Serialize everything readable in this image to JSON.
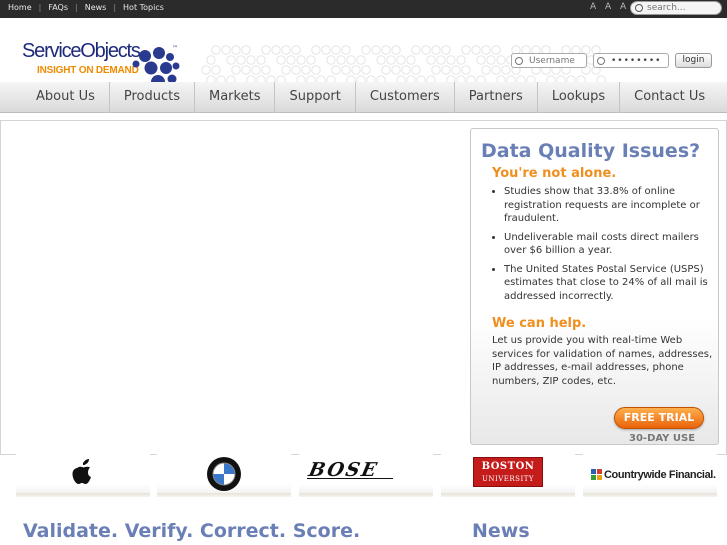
{
  "topbar": {
    "links": [
      "Home",
      "FAQs",
      "News",
      "Hot Topics"
    ],
    "font_size_label": "A A A",
    "search_placeholder": "search..."
  },
  "header": {
    "logo_name": "ServiceObjects",
    "logo_trademark": "™",
    "logo_tagline": "INSIGHT ON DEMAND",
    "username_placeholder": "Username",
    "password_value": "••••••••",
    "login_label": "login"
  },
  "nav": {
    "items": [
      "About Us",
      "Products",
      "Markets",
      "Support",
      "Customers",
      "Partners",
      "Lookups",
      "Contact Us"
    ]
  },
  "promo": {
    "title": "Data Quality Issues?",
    "subtitle": "You're not alone.",
    "bullets": [
      "Studies show that 33.8% of online registration requests are incomplete or fraudulent.",
      "Undeliverable mail costs direct mailers over $6 billion a year.",
      "The United States Postal Service (USPS) estimates that close to 24% of all mail is addressed incorrectly."
    ],
    "help_heading": "We can help.",
    "help_text": "Let us provide you with real-time Web services for validation of names, addresses, IP addresses, e-mail addresses, phone numbers, ZIP codes, etc.",
    "trial_label": "FREE TRIAL",
    "trial_note": "30-DAY USE"
  },
  "clients": {
    "bose": "BOSE",
    "boston_line1": "BOSTON",
    "boston_line2": "UNIVERSITY",
    "countrywide": "Countrywide Financial."
  },
  "sections": {
    "main_heading": "Validate. Verify. Correct. Score.",
    "news_heading": "News"
  },
  "colors": {
    "brand_blue": "#1d2a7a",
    "accent_orange": "#ef8f1f",
    "heading_blue": "#6a7fb6"
  }
}
